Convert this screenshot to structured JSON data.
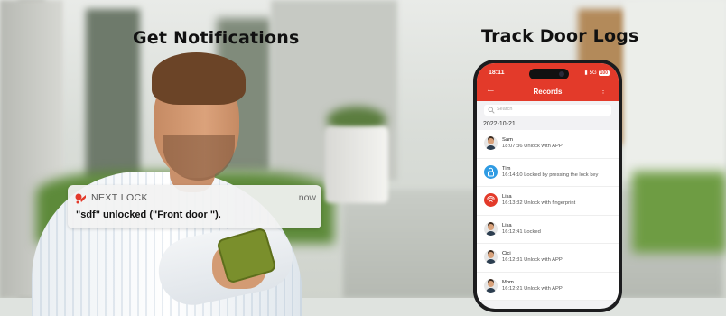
{
  "headings": {
    "left": "Get Notifications",
    "right": "Track Door Logs"
  },
  "notification": {
    "app_name": "NEXT LOCK",
    "time": "now",
    "message": "\"sdf\" unlocked (\"Front door \")."
  },
  "phone": {
    "status": {
      "time": "18:11",
      "network": "5G",
      "battery": "100"
    },
    "title": "Records",
    "back_icon": "arrow-left-icon",
    "menu_icon": "more-vertical-icon",
    "search_placeholder": "Search",
    "date": "2022-10-21",
    "records": [
      {
        "name": "Sam",
        "desc": "18:07:36 Unlock with APP",
        "icon": "person"
      },
      {
        "name": "Tim",
        "desc": "16:14:10 Locked by pressing the lock key",
        "icon": "lock"
      },
      {
        "name": "Lisa",
        "desc": "16:13:32 Unlock with fingerprint",
        "icon": "fingerprint"
      },
      {
        "name": "Lisa",
        "desc": "16:12:41 Locked",
        "icon": "person"
      },
      {
        "name": "Cici",
        "desc": "16:12:31 Unlock with APP",
        "icon": "person"
      },
      {
        "name": "Mom",
        "desc": "16:12:21 Unlock with APP",
        "icon": "person"
      }
    ]
  },
  "colors": {
    "accent": "#e33a2a",
    "lock_blue": "#2f9be3"
  }
}
